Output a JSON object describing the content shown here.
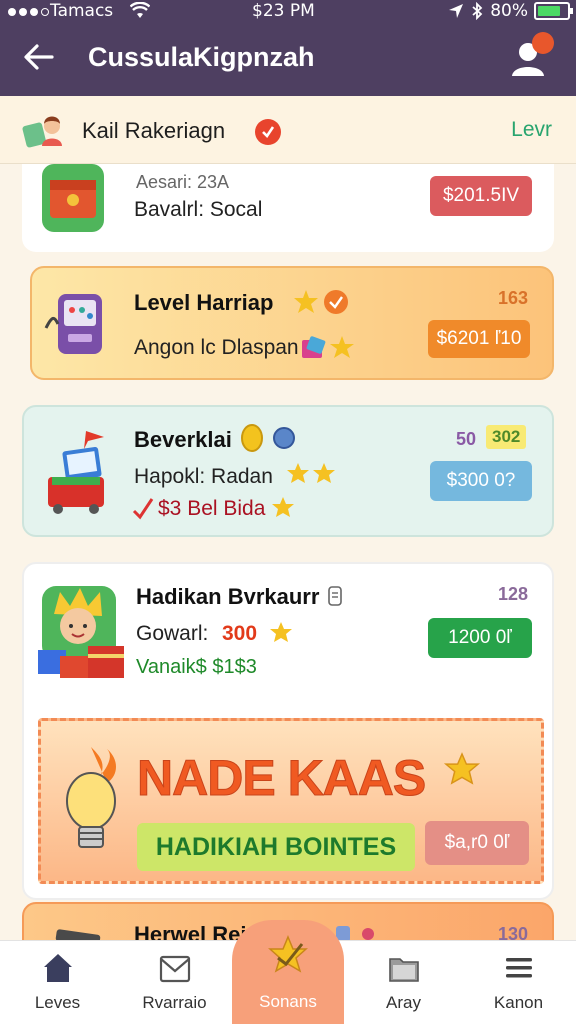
{
  "status_bar": {
    "carrier": "Tamacs",
    "time": "$23 PM",
    "battery": "80%",
    "battery_level": 0.8
  },
  "app_bar": {
    "title": "CussulaKigpnzah",
    "notification_count": ""
  },
  "sub_header": {
    "title": "Kail Rakeriagn",
    "link": "Levr"
  },
  "cards": [
    {
      "small": "Aesari: 23A",
      "desc": "Bavalrl: Socal",
      "button": "$201.5IV",
      "button_color": "#db5b5e"
    },
    {
      "name": "Level Harriap",
      "desc": "Angon lc Dlaspan",
      "count": "163",
      "button": "$6201 ľ10",
      "button_color": "#f08a2a"
    },
    {
      "name": "Beverklai",
      "count": "50",
      "count_tag": "302",
      "desc": "Hapokl: Radan",
      "price_line": "$3 Bel Bida",
      "button": "$300 0?",
      "button_color": "#75b8de"
    },
    {
      "name": "Hadikan Bvrkaurr",
      "count": "128",
      "desc_label": "Gowarl:",
      "desc_value": "300",
      "sub_line": "Vanaik$ $1$3",
      "button": "1200 0ľ",
      "button_color": "#27a34a"
    },
    {
      "name": "Herwel Rein",
      "count": "130"
    }
  ],
  "promo": {
    "title": "NADE KAAS",
    "subtitle": "HADIKIAH BOINTES",
    "button": "$a,r0 0ľ"
  },
  "bottom_nav": [
    {
      "label": "Leves",
      "icon": "home-icon"
    },
    {
      "label": "Rvarraio",
      "icon": "mail-icon"
    },
    {
      "label": "Sonans",
      "icon": "check-star-icon"
    },
    {
      "label": "Aray",
      "icon": "folder-icon"
    },
    {
      "label": "Kanon",
      "icon": "menu-icon"
    }
  ]
}
